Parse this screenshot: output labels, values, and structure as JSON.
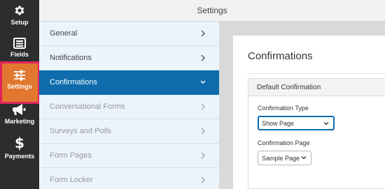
{
  "header": {
    "title": "Settings"
  },
  "rail": {
    "items": [
      {
        "label": "Setup",
        "icon": "gear-icon"
      },
      {
        "label": "Fields",
        "icon": "form-fields-icon"
      },
      {
        "label": "Settings",
        "icon": "sliders-icon",
        "active": true
      },
      {
        "label": "Marketing",
        "icon": "megaphone-icon"
      },
      {
        "label": "Payments",
        "icon": "dollar-icon"
      }
    ],
    "active_color": "#e27730",
    "highlight_color": "#e0245e"
  },
  "submenu": {
    "items": [
      {
        "label": "General"
      },
      {
        "label": "Notifications"
      },
      {
        "label": "Confirmations",
        "active": true
      },
      {
        "label": "Conversational Forms",
        "disabled": true
      },
      {
        "label": "Surveys and Polls",
        "disabled": true
      },
      {
        "label": "Form Pages",
        "disabled": true
      },
      {
        "label": "Form Locker",
        "disabled": true
      }
    ],
    "active_color": "#0e6cad"
  },
  "content": {
    "title": "Confirmations",
    "panel_title": "Default Confirmation",
    "confirmation_type": {
      "label": "Confirmation Type",
      "value": "Show Page"
    },
    "confirmation_page": {
      "label": "Confirmation Page",
      "value": "Sample Page"
    }
  }
}
